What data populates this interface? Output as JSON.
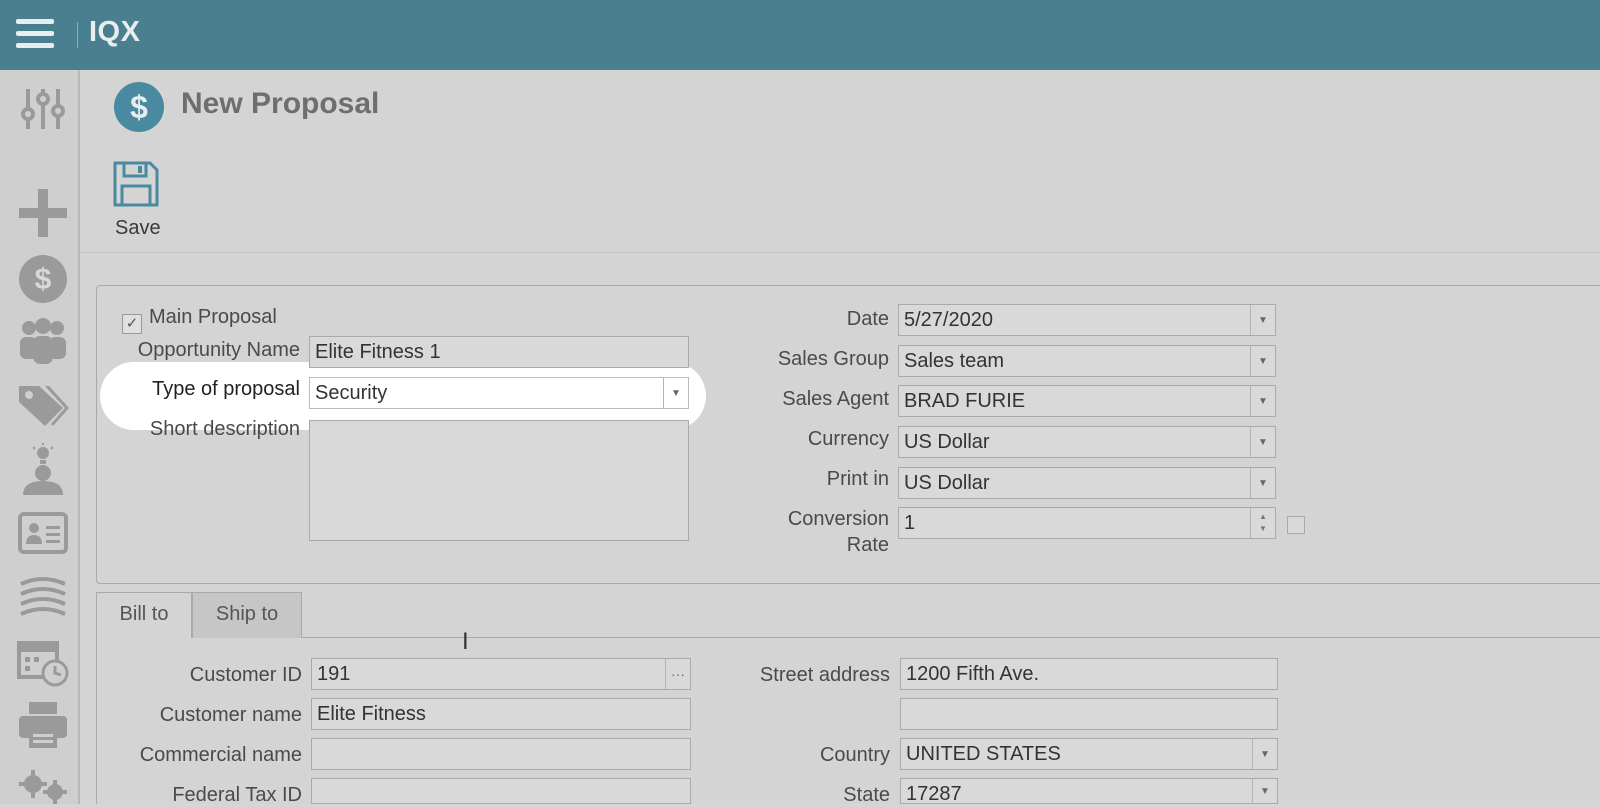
{
  "app": {
    "brand": "IQX"
  },
  "page": {
    "title": "New Proposal",
    "title_icon_glyph": "$"
  },
  "toolbar": {
    "save_label": "Save"
  },
  "sidebar": {
    "icons": [
      "sliders-icon",
      "plus-icon",
      "dollar-circle-icon",
      "people-icon",
      "tags-icon",
      "user-idea-icon",
      "contact-card-icon",
      "stack-icon",
      "calendar-clock-icon",
      "printer-icon",
      "gears-icon"
    ]
  },
  "proposal": {
    "main_proposal_label": "Main Proposal",
    "main_proposal_checked": true,
    "opportunity_name": {
      "label": "Opportunity Name",
      "value": "Elite Fitness 1"
    },
    "type_of_proposal": {
      "label": "Type of proposal",
      "value": "Security"
    },
    "short_description": {
      "label": "Short description",
      "value": ""
    },
    "date": {
      "label": "Date",
      "value": "5/27/2020"
    },
    "sales_group": {
      "label": "Sales Group",
      "value": "Sales team"
    },
    "sales_agent": {
      "label": "Sales Agent",
      "value": "BRAD FURIE"
    },
    "currency": {
      "label": "Currency",
      "value": "US Dollar"
    },
    "print_in": {
      "label": "Print in",
      "value": "US Dollar"
    },
    "conversion_rate": {
      "label_line1": "Conversion",
      "label_line2": "Rate",
      "value": "1"
    }
  },
  "tabs": [
    {
      "label": "Bill to",
      "active": true
    },
    {
      "label": "Ship to",
      "active": false
    }
  ],
  "bill_to": {
    "customer_id": {
      "label": "Customer ID",
      "value": "191"
    },
    "customer_name": {
      "label": "Customer name",
      "value": "Elite Fitness"
    },
    "commercial_name": {
      "label": "Commercial name",
      "value": ""
    },
    "federal_tax_id": {
      "label": "Federal Tax ID",
      "value": ""
    },
    "street_address": {
      "label": "Street address",
      "value": "1200 Fifth Ave.",
      "line2": ""
    },
    "country": {
      "label": "Country",
      "value": "UNITED STATES"
    },
    "state": {
      "label": "State",
      "value": "17287"
    }
  },
  "colors": {
    "topbar": "#4a7f90",
    "accent": "#4a8aa0",
    "background": "#d4d4d4",
    "highlight": "#ffffff"
  }
}
